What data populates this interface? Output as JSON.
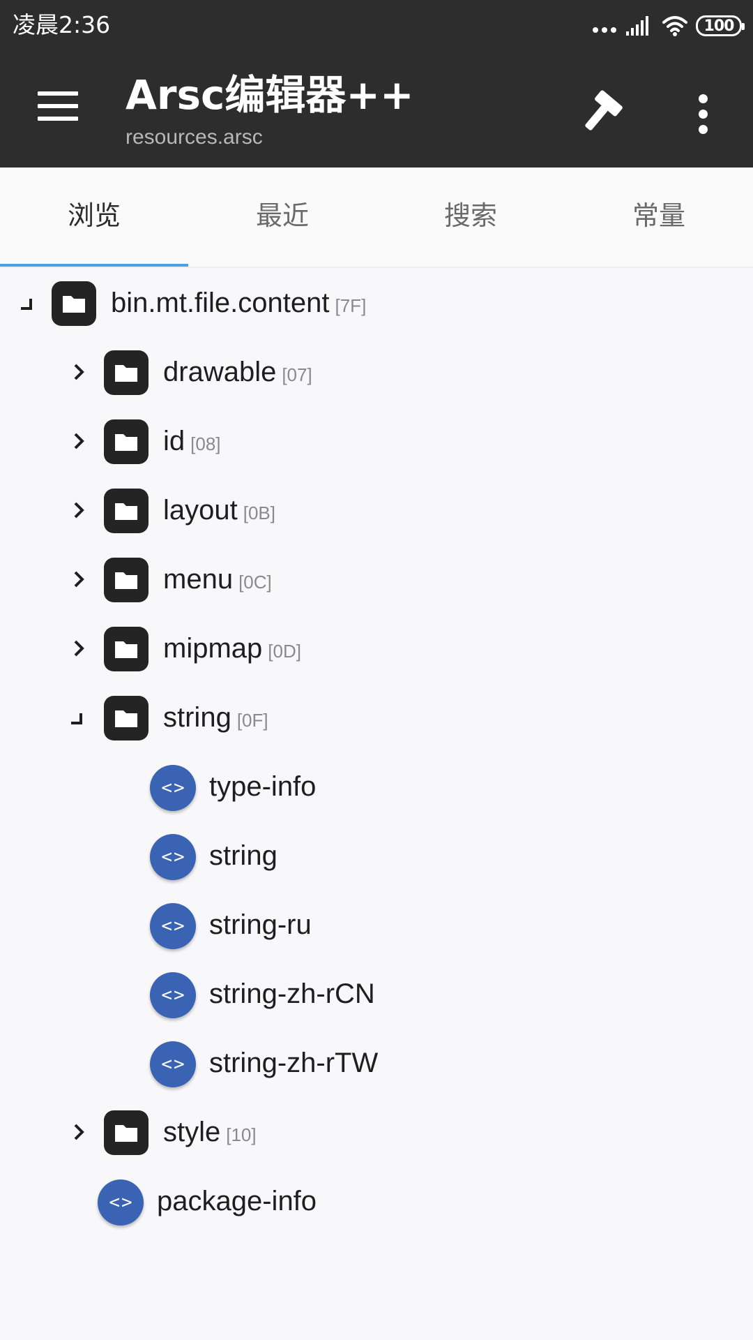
{
  "status_bar": {
    "time": "凌晨2:36",
    "battery": "100"
  },
  "toolbar": {
    "title": "Arsc编辑器++",
    "subtitle": "resources.arsc",
    "icons": [
      "menu-icon",
      "hammer-icon",
      "more-vert-icon"
    ]
  },
  "tabs": [
    {
      "label": "浏览",
      "active": true
    },
    {
      "label": "最近",
      "active": false
    },
    {
      "label": "搜索",
      "active": false
    },
    {
      "label": "常量",
      "active": false
    }
  ],
  "tree": {
    "root": {
      "label": "bin.mt.file.content",
      "tag": "[7F]",
      "expanded": true
    },
    "types": [
      {
        "label": "drawable",
        "tag": "[07]",
        "expanded": false
      },
      {
        "label": "id",
        "tag": "[08]",
        "expanded": false
      },
      {
        "label": "layout",
        "tag": "[0B]",
        "expanded": false
      },
      {
        "label": "menu",
        "tag": "[0C]",
        "expanded": false
      },
      {
        "label": "mipmap",
        "tag": "[0D]",
        "expanded": false
      },
      {
        "label": "string",
        "tag": "[0F]",
        "expanded": true
      },
      {
        "label": "style",
        "tag": "[10]",
        "expanded": false
      }
    ],
    "string_children": [
      "type-info",
      "string",
      "string-ru",
      "string-zh-rCN",
      "string-zh-rTW"
    ],
    "package_info": "package-info",
    "code_glyph": "<>"
  },
  "colors": {
    "toolbar": "#2d2d2d",
    "tab_indicator": "#4a9fe6",
    "code_badge": "#3a63b3",
    "folder": "#242424"
  }
}
